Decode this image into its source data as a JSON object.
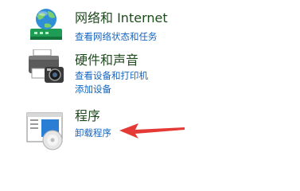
{
  "categories": [
    {
      "title": "网络和 Internet",
      "icon": "network-globe-icon",
      "links": [
        "查看网络状态和任务"
      ]
    },
    {
      "title": "硬件和声音",
      "icon": "printer-camera-icon",
      "links": [
        "查看设备和打印机",
        "添加设备"
      ]
    },
    {
      "title": "程序",
      "icon": "programs-disc-icon",
      "links": [
        "卸载程序"
      ]
    }
  ],
  "colors": {
    "title": "#1e4a1e",
    "link": "#1565c0",
    "arrow": "#e53935"
  }
}
